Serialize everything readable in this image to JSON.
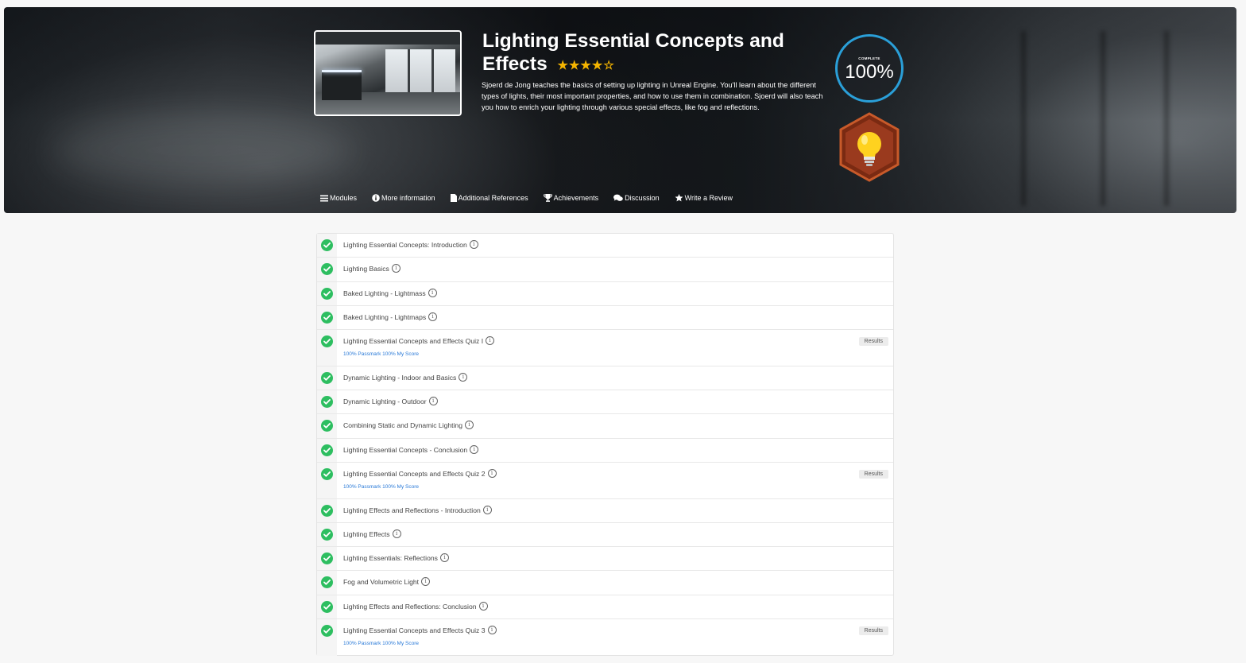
{
  "course": {
    "title": "Lighting Essential Concepts and Effects",
    "rating": 4,
    "rating_max": 5,
    "description": "Sjoerd de Jong teaches the basics of setting up lighting in Unreal Engine. You'll learn about the different types of lights, their most important properties, and how to use them in combination. Sjoerd will also teach you how to enrich your lighting through various special effects, like fog and reflections.",
    "progress_label": "COMPLETE",
    "progress_value": "100%"
  },
  "tabs": [
    {
      "label": "Modules",
      "icon": "list-icon"
    },
    {
      "label": "More information",
      "icon": "info-circle-icon"
    },
    {
      "label": "Additional References",
      "icon": "document-icon"
    },
    {
      "label": "Achievements",
      "icon": "trophy-icon"
    },
    {
      "label": "Discussion",
      "icon": "chat-bubbles-icon"
    },
    {
      "label": "Write a Review",
      "icon": "star-icon"
    }
  ],
  "modules": [
    {
      "name": "Lighting Essential Concepts: Introduction"
    },
    {
      "name": "Lighting Basics"
    },
    {
      "name": "Baked Lighting - Lightmass"
    },
    {
      "name": "Baked Lighting - Lightmaps"
    },
    {
      "name": "Lighting Essential Concepts and Effects Quiz I",
      "score": "100% Passmark 100% My Score",
      "results": "Results"
    },
    {
      "name": "Dynamic Lighting - Indoor and Basics"
    },
    {
      "name": "Dynamic Lighting - Outdoor"
    },
    {
      "name": "Combining Static and Dynamic Lighting"
    },
    {
      "name": "Lighting Essential Concepts - Conclusion"
    },
    {
      "name": "Lighting Essential Concepts and Effects Quiz 2",
      "score": "100% Passmark 100% My Score",
      "results": "Results"
    },
    {
      "name": "Lighting Effects and Reflections - Introduction"
    },
    {
      "name": "Lighting Effects"
    },
    {
      "name": "Lighting Essentials: Reflections"
    },
    {
      "name": "Fog and Volumetric Light"
    },
    {
      "name": "Lighting Effects and Reflections: Conclusion"
    },
    {
      "name": "Lighting Essential Concepts and Effects Quiz 3",
      "score": "100% Passmark 100% My Score",
      "results": "Results"
    }
  ],
  "colors": {
    "check": "#2dbe60",
    "progress_ring": "#2a9fd8",
    "star": "#f4b400",
    "score_link": "#2a7ad8",
    "badge_fill": "#9a3a1e"
  }
}
